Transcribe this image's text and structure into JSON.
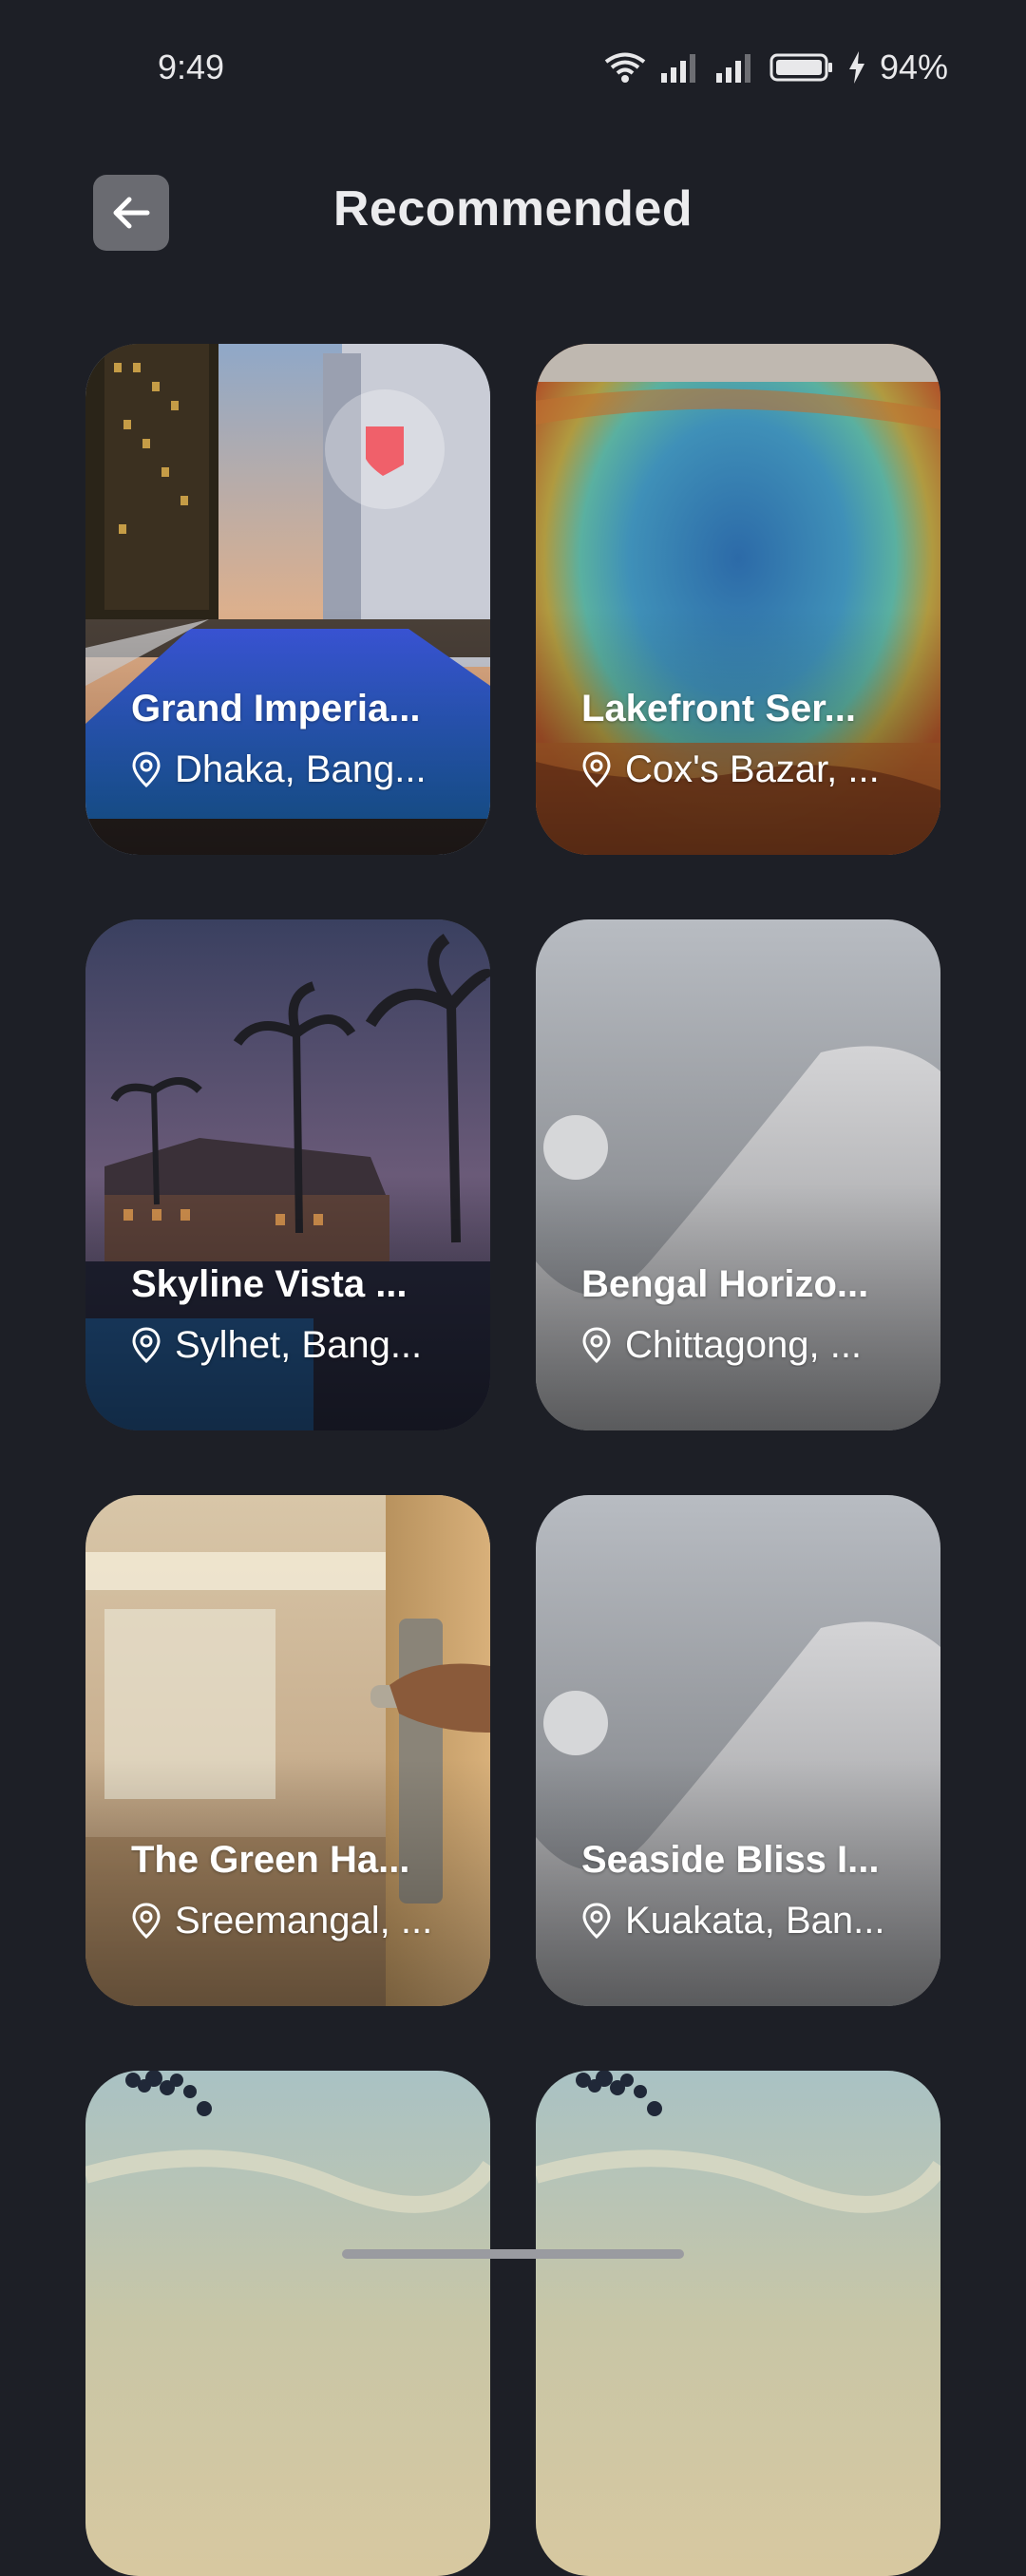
{
  "status": {
    "time": "9:49",
    "battery": "94%"
  },
  "header": {
    "title": "Recommended"
  },
  "cards": [
    {
      "name": "Grand Imperia...",
      "location": "Dhaka, Bang...",
      "image": "city-pool-photo",
      "favorite": true
    },
    {
      "name": "Lakefront Ser...",
      "location": "Cox's Bazar, ...",
      "image": "hot-spring-photo"
    },
    {
      "name": "Skyline Vista ...",
      "location": "Sylhet, Bang...",
      "image": "palm-resort-photo"
    },
    {
      "name": "Bengal Horizo...",
      "location": "Chittagong, ...",
      "image": "image-placeholder"
    },
    {
      "name": "The Green Ha...",
      "location": "Sreemangal, ...",
      "image": "hotel-door-photo"
    },
    {
      "name": "Seaside Bliss I...",
      "location": "Kuakata, Ban...",
      "image": "image-placeholder"
    },
    {
      "name": "",
      "location": "",
      "image": "sky-tree-photo"
    },
    {
      "name": "",
      "location": "",
      "image": "sky-tree-photo"
    }
  ],
  "colors": {
    "background": "#1d1f26",
    "favorite_accent": "#f0606a"
  }
}
